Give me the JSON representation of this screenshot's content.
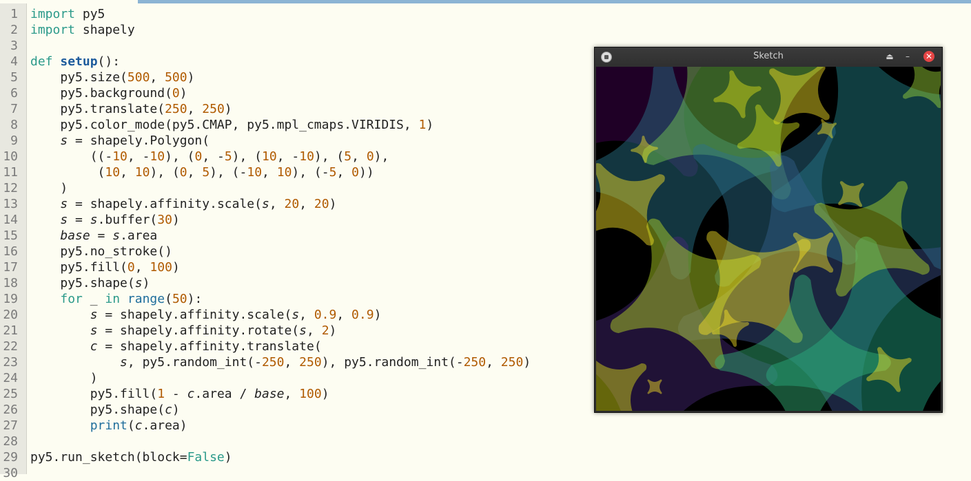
{
  "editor": {
    "lines": [
      {
        "n": "1",
        "tokens": [
          {
            "t": "import",
            "c": "kw"
          },
          {
            "t": " py5"
          }
        ]
      },
      {
        "n": "2",
        "tokens": [
          {
            "t": "import",
            "c": "kw"
          },
          {
            "t": " shapely"
          }
        ]
      },
      {
        "n": "3",
        "tokens": []
      },
      {
        "n": "4",
        "tokens": [
          {
            "t": "def",
            "c": "kw"
          },
          {
            "t": " "
          },
          {
            "t": "setup",
            "c": "fn"
          },
          {
            "t": "():"
          }
        ]
      },
      {
        "n": "5",
        "tokens": [
          {
            "t": "    py5.size("
          },
          {
            "t": "500",
            "c": "num"
          },
          {
            "t": ", "
          },
          {
            "t": "500",
            "c": "num"
          },
          {
            "t": ")"
          }
        ]
      },
      {
        "n": "6",
        "tokens": [
          {
            "t": "    py5.background("
          },
          {
            "t": "0",
            "c": "num"
          },
          {
            "t": ")"
          }
        ]
      },
      {
        "n": "7",
        "tokens": [
          {
            "t": "    py5.translate("
          },
          {
            "t": "250",
            "c": "num"
          },
          {
            "t": ", "
          },
          {
            "t": "250",
            "c": "num"
          },
          {
            "t": ")"
          }
        ]
      },
      {
        "n": "8",
        "tokens": [
          {
            "t": "    py5.color_mode(py5.CMAP, py5.mpl_cmaps.VIRIDIS, "
          },
          {
            "t": "1",
            "c": "num"
          },
          {
            "t": ")"
          }
        ]
      },
      {
        "n": "9",
        "tokens": [
          {
            "t": "    "
          },
          {
            "t": "s",
            "c": "var"
          },
          {
            "t": " = shapely.Polygon("
          }
        ]
      },
      {
        "n": "10",
        "tokens": [
          {
            "t": "        ((-"
          },
          {
            "t": "10",
            "c": "num"
          },
          {
            "t": ", -"
          },
          {
            "t": "10",
            "c": "num"
          },
          {
            "t": "), ("
          },
          {
            "t": "0",
            "c": "num"
          },
          {
            "t": ", -"
          },
          {
            "t": "5",
            "c": "num"
          },
          {
            "t": "), ("
          },
          {
            "t": "10",
            "c": "num"
          },
          {
            "t": ", -"
          },
          {
            "t": "10",
            "c": "num"
          },
          {
            "t": "), ("
          },
          {
            "t": "5",
            "c": "num"
          },
          {
            "t": ", "
          },
          {
            "t": "0",
            "c": "num"
          },
          {
            "t": "),"
          }
        ]
      },
      {
        "n": "11",
        "tokens": [
          {
            "t": "         ("
          },
          {
            "t": "10",
            "c": "num"
          },
          {
            "t": ", "
          },
          {
            "t": "10",
            "c": "num"
          },
          {
            "t": "), ("
          },
          {
            "t": "0",
            "c": "num"
          },
          {
            "t": ", "
          },
          {
            "t": "5",
            "c": "num"
          },
          {
            "t": "), (-"
          },
          {
            "t": "10",
            "c": "num"
          },
          {
            "t": ", "
          },
          {
            "t": "10",
            "c": "num"
          },
          {
            "t": "), (-"
          },
          {
            "t": "5",
            "c": "num"
          },
          {
            "t": ", "
          },
          {
            "t": "0",
            "c": "num"
          },
          {
            "t": "))"
          }
        ]
      },
      {
        "n": "12",
        "tokens": [
          {
            "t": "    )"
          }
        ]
      },
      {
        "n": "13",
        "tokens": [
          {
            "t": "    "
          },
          {
            "t": "s",
            "c": "var"
          },
          {
            "t": " = shapely.affinity.scale("
          },
          {
            "t": "s",
            "c": "var"
          },
          {
            "t": ", "
          },
          {
            "t": "20",
            "c": "num"
          },
          {
            "t": ", "
          },
          {
            "t": "20",
            "c": "num"
          },
          {
            "t": ")"
          }
        ]
      },
      {
        "n": "14",
        "tokens": [
          {
            "t": "    "
          },
          {
            "t": "s",
            "c": "var"
          },
          {
            "t": " = "
          },
          {
            "t": "s",
            "c": "var"
          },
          {
            "t": ".buffer("
          },
          {
            "t": "30",
            "c": "num"
          },
          {
            "t": ")"
          }
        ]
      },
      {
        "n": "15",
        "tokens": [
          {
            "t": "    "
          },
          {
            "t": "base",
            "c": "var"
          },
          {
            "t": " = "
          },
          {
            "t": "s",
            "c": "var"
          },
          {
            "t": ".area"
          }
        ]
      },
      {
        "n": "16",
        "tokens": [
          {
            "t": "    py5.no_stroke()"
          }
        ]
      },
      {
        "n": "17",
        "tokens": [
          {
            "t": "    py5.fill("
          },
          {
            "t": "0",
            "c": "num"
          },
          {
            "t": ", "
          },
          {
            "t": "100",
            "c": "num"
          },
          {
            "t": ")"
          }
        ]
      },
      {
        "n": "18",
        "tokens": [
          {
            "t": "    py5.shape("
          },
          {
            "t": "s",
            "c": "var"
          },
          {
            "t": ")"
          }
        ]
      },
      {
        "n": "19",
        "tokens": [
          {
            "t": "    "
          },
          {
            "t": "for",
            "c": "kw"
          },
          {
            "t": " _ "
          },
          {
            "t": "in",
            "c": "kw"
          },
          {
            "t": " "
          },
          {
            "t": "range",
            "c": "bi"
          },
          {
            "t": "("
          },
          {
            "t": "50",
            "c": "num"
          },
          {
            "t": "):"
          }
        ]
      },
      {
        "n": "20",
        "tokens": [
          {
            "t": "        "
          },
          {
            "t": "s",
            "c": "var"
          },
          {
            "t": " = shapely.affinity.scale("
          },
          {
            "t": "s",
            "c": "var"
          },
          {
            "t": ", "
          },
          {
            "t": "0.9",
            "c": "num"
          },
          {
            "t": ", "
          },
          {
            "t": "0.9",
            "c": "num"
          },
          {
            "t": ")"
          }
        ]
      },
      {
        "n": "21",
        "tokens": [
          {
            "t": "        "
          },
          {
            "t": "s",
            "c": "var"
          },
          {
            "t": " = shapely.affinity.rotate("
          },
          {
            "t": "s",
            "c": "var"
          },
          {
            "t": ", "
          },
          {
            "t": "2",
            "c": "num"
          },
          {
            "t": ")"
          }
        ]
      },
      {
        "n": "22",
        "tokens": [
          {
            "t": "        "
          },
          {
            "t": "c",
            "c": "var"
          },
          {
            "t": " = shapely.affinity.translate("
          }
        ]
      },
      {
        "n": "23",
        "tokens": [
          {
            "t": "            "
          },
          {
            "t": "s",
            "c": "var"
          },
          {
            "t": ", py5.random_int(-"
          },
          {
            "t": "250",
            "c": "num"
          },
          {
            "t": ", "
          },
          {
            "t": "250",
            "c": "num"
          },
          {
            "t": "), py5.random_int(-"
          },
          {
            "t": "250",
            "c": "num"
          },
          {
            "t": ", "
          },
          {
            "t": "250",
            "c": "num"
          },
          {
            "t": ")"
          }
        ]
      },
      {
        "n": "24",
        "tokens": [
          {
            "t": "        )"
          }
        ]
      },
      {
        "n": "25",
        "tokens": [
          {
            "t": "        py5.fill("
          },
          {
            "t": "1",
            "c": "num"
          },
          {
            "t": " - "
          },
          {
            "t": "c",
            "c": "var"
          },
          {
            "t": ".area / "
          },
          {
            "t": "base",
            "c": "var"
          },
          {
            "t": ", "
          },
          {
            "t": "100",
            "c": "num"
          },
          {
            "t": ")"
          }
        ]
      },
      {
        "n": "26",
        "tokens": [
          {
            "t": "        py5.shape("
          },
          {
            "t": "c",
            "c": "var"
          },
          {
            "t": ")"
          }
        ]
      },
      {
        "n": "27",
        "tokens": [
          {
            "t": "        "
          },
          {
            "t": "print",
            "c": "bi"
          },
          {
            "t": "("
          },
          {
            "t": "c",
            "c": "var"
          },
          {
            "t": ".area)"
          }
        ]
      },
      {
        "n": "28",
        "tokens": []
      },
      {
        "n": "29",
        "tokens": [
          {
            "t": "py5.run_sketch(block="
          },
          {
            "t": "False",
            "c": "kw"
          },
          {
            "t": ")"
          }
        ]
      },
      {
        "n": "30",
        "tokens": []
      }
    ]
  },
  "sketch_window": {
    "title": "Sketch",
    "minimize_glyph": "⏏",
    "restore_glyph": "–",
    "close_glyph": "✕",
    "icons": {
      "app": "py5-app-icon",
      "close": "close-icon"
    }
  },
  "colors": {
    "editor_bg": "#fdfdf2",
    "keyword": "#2b9a8a",
    "number": "#b05a00",
    "function": "#1d5b9c",
    "close_button": "#e54545"
  }
}
